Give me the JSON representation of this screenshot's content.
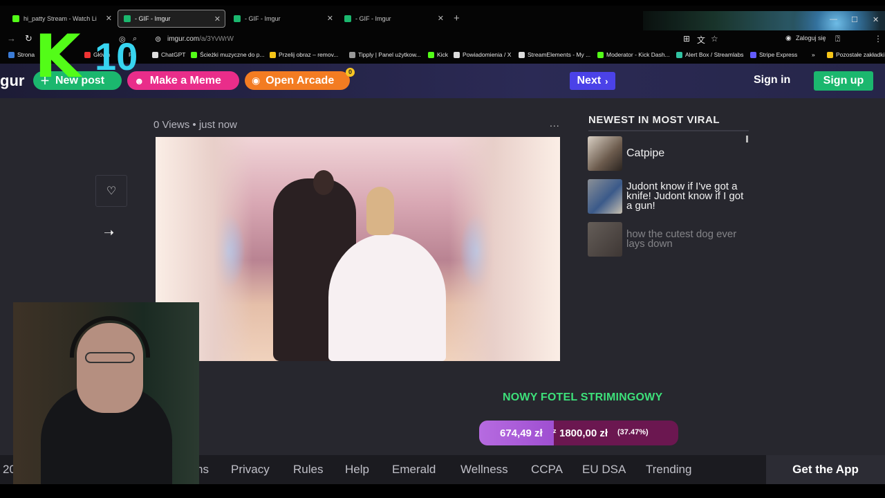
{
  "tabs": [
    {
      "title": "hi_patty Stream - Watch Li",
      "active": false,
      "color": "#53fc18"
    },
    {
      "title": "- GIF - Imgur",
      "active": true,
      "color": "#1bb76e"
    },
    {
      "title": "- GIF - Imgur",
      "active": false,
      "color": "#1bb76e"
    },
    {
      "title": "- GIF - Imgur",
      "active": false,
      "color": "#1bb76e"
    }
  ],
  "address": {
    "domain": "imgur.com",
    "path": "/a/3YvWrW",
    "login_label": "Zaloguj się"
  },
  "bookmarks": [
    {
      "label": "Strona",
      "color": "#3a7bd5"
    },
    {
      "label": "Główn",
      "color": "#e33"
    },
    {
      "label": "Po",
      "color": "#888"
    },
    {
      "label": "ChatGPT",
      "color": "#ddd"
    },
    {
      "label": "Ścieżki muzyczne do p...",
      "color": "#53fc18"
    },
    {
      "label": "Przelij obraz – remov...",
      "color": "#f5c518"
    },
    {
      "label": "Tipply | Panel użytkow...",
      "color": "#999"
    },
    {
      "label": "Kick",
      "color": "#53fc18"
    },
    {
      "label": "Powiadomienia / X",
      "color": "#ddd"
    },
    {
      "label": "StreamElements - My ...",
      "color": "#ddd"
    },
    {
      "label": "Moderator - Kick Dash...",
      "color": "#53fc18"
    },
    {
      "label": "Alert Box / Streamlabs",
      "color": "#31c3a2"
    },
    {
      "label": "Stripe Express",
      "color": "#635bff"
    },
    {
      "label": "Pozostałe zakładki",
      "color": "#f5c518"
    }
  ],
  "nav": {
    "logo_fragment": "gur",
    "new_post": "New post",
    "make_meme": "Make a Meme",
    "open_arcade": "Open Arcade",
    "arcade_badge": "0",
    "next": "Next",
    "sign_in": "Sign in",
    "sign_up": "Sign up"
  },
  "post": {
    "meta": "0 Views • just now",
    "more": "..."
  },
  "viral": {
    "title": "NEWEST IN MOST VIRAL",
    "items": [
      {
        "text": "Catpipe"
      },
      {
        "text": "Judont know if I've got a knife! Judont know if I got a gun!"
      },
      {
        "text": "how the cutest dog ever lays down"
      }
    ]
  },
  "promo": {
    "title": "NOWY FOTEL STRIMINGOWY",
    "current": "674,49 zł",
    "separator": "z",
    "target": "1800,00 zł",
    "percent": "(37.47%)",
    "fraction": 0.3747
  },
  "footer": {
    "left_fragment": "20",
    "links": [
      "ns",
      "Privacy",
      "Rules",
      "Help",
      "Emerald",
      "Wellness",
      "CCPA",
      "EU DSA",
      "Trending"
    ],
    "get_app": "Get the App"
  },
  "overlay": {
    "kick_letter": "K",
    "kick_number": "10"
  }
}
